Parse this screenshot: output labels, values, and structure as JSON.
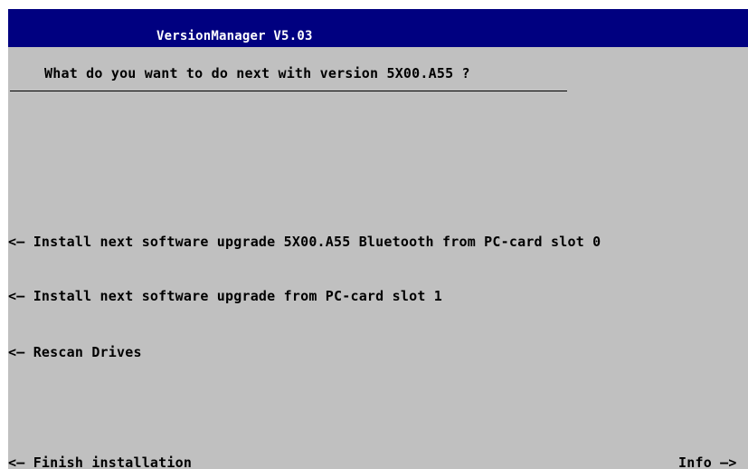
{
  "window": {
    "title": "VersionManager V5.03"
  },
  "prompt": {
    "question": "What do you want to do next with version 5X00.A55 ?"
  },
  "options": [
    {
      "arrow": "<—",
      "label": "Install next software upgrade 5X00.A55 Bluetooth from PC-card slot 0"
    },
    {
      "arrow": "<—",
      "label": "Install next software upgrade from PC-card slot 1"
    },
    {
      "arrow": "<—",
      "label": "Rescan Drives"
    },
    {
      "arrow": "<—",
      "label": "Finish installation"
    }
  ],
  "info": {
    "label": "Info",
    "arrow": "—>"
  },
  "colors": {
    "title_bar": "#000080",
    "background": "#c0c0c0",
    "text": "#000000",
    "title_text": "#ffffff"
  }
}
